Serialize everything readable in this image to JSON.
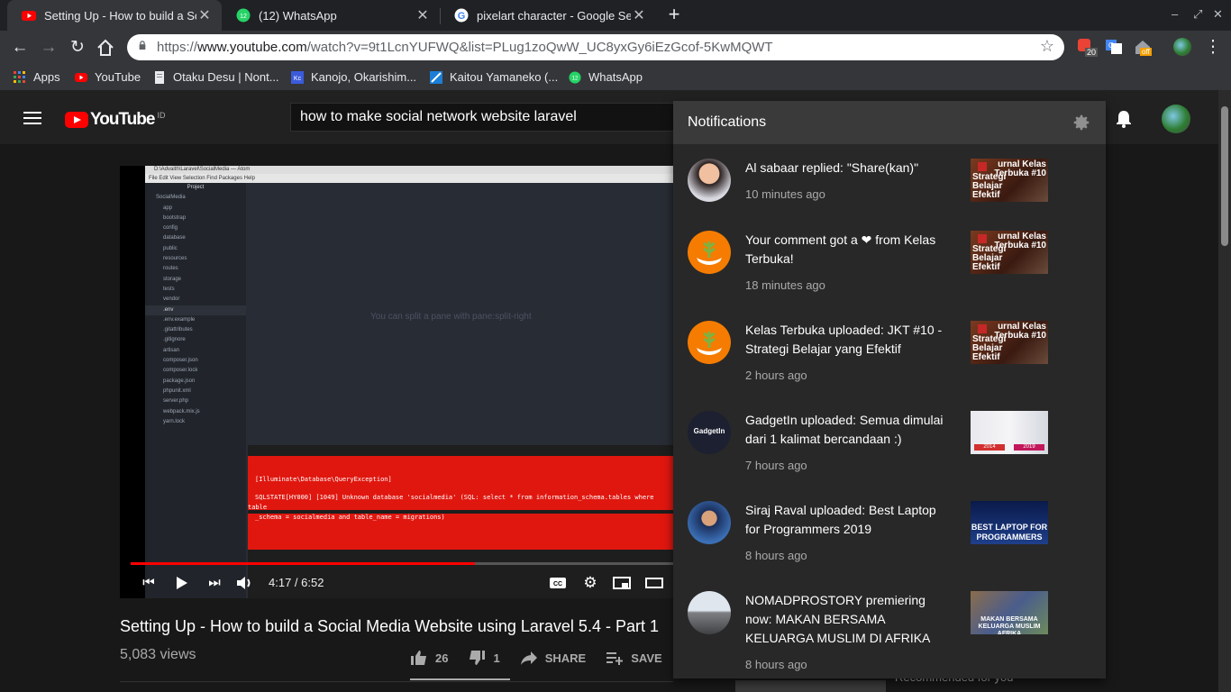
{
  "browser": {
    "tabs": [
      {
        "title": "Setting Up - How to build a Soci",
        "active": true
      },
      {
        "title": "(12) WhatsApp",
        "active": false
      },
      {
        "title": "pixelart character - Google Sea",
        "active": false
      }
    ],
    "new_tab_label": "+",
    "url_prefix": "https://",
    "url_host": "www.youtube.com",
    "url_path": "/watch?v=9t1LcnYUFWQ&list=PLug1zoQwW_UC8yxGy6iEzGcof-5KwMQWT",
    "extension_badges": {
      "pocket": "20",
      "ext3": "off"
    },
    "whatsapp_badge": "12",
    "bookmarks": [
      {
        "label": "Apps",
        "icon": "apps-grid-icon"
      },
      {
        "label": "YouTube",
        "icon": "youtube-icon"
      },
      {
        "label": "Otaku Desu | Nont...",
        "icon": "page-icon"
      },
      {
        "label": "Kanojo, Okarishim...",
        "icon": "kc-icon"
      },
      {
        "label": "Kaitou Yamaneko (...",
        "icon": "ky-icon"
      },
      {
        "label": "WhatsApp",
        "icon": "whatsapp-icon"
      }
    ]
  },
  "youtube": {
    "logo_text": "YouTube",
    "logo_country": "ID",
    "search_value": "how to make social network website laravel"
  },
  "video": {
    "editor": {
      "titlebar": "D:\\Advaith\\Laravel\\SocialMedia — Atom",
      "menu": "File   Edit   View   Selection   Find   Packages   Help",
      "project_label": "Project",
      "tree": [
        "SocialMedia",
        "app",
        "bootstrap",
        "config",
        "database",
        "public",
        "resources",
        "routes",
        "storage",
        "tests",
        "vendor",
        ".env",
        ".env.example",
        ".gitattributes",
        ".gitignore",
        "artisan",
        "composer.json",
        "composer.lock",
        "package.json",
        "phpunit.xml",
        "server.php",
        "webpack.mix.js",
        "yarn.lock"
      ],
      "hint": "You can split a pane with pane:split-right",
      "error_lines": [
        "[Illuminate\\Database\\QueryException]",
        "SQLSTATE[HY000] [1049] Unknown database 'socialmedia' (SQL: select * from information_schema.tables where",
        "table",
        "_schema = socialmedia and table_name = migrations)"
      ]
    },
    "progress": 0.635,
    "buffered": 0.925,
    "time_current": "4:17",
    "time_total": "6:52",
    "title": "Setting Up - How to build a Social Media Website using Laravel 5.4 - Part 1",
    "views": "5,083 views",
    "likes": "26",
    "dislikes": "1",
    "share_label": "SHARE",
    "save_label": "SAVE",
    "sidebar_peek": "Recommended for you"
  },
  "notifications": {
    "title": "Notifications",
    "items": [
      {
        "text": "Al sabaar replied: \"Share(kan)\"",
        "time": "10 minutes ago",
        "avatar": "person-avatar",
        "thumb": "kelas-terbuka",
        "thumb_title": "urnal Kelas Terbuka #10",
        "thumb_sub": "Strategi Belajar Efektif"
      },
      {
        "text": "Your comment got a ❤ from Kelas Terbuka!",
        "time": "18 minutes ago",
        "avatar": "kelas-terbuka-avatar",
        "thumb": "kelas-terbuka",
        "thumb_title": "urnal Kelas Terbuka #10",
        "thumb_sub": "Strategi Belajar Efektif"
      },
      {
        "text": "Kelas Terbuka uploaded: JKT #10 - Strategi Belajar yang Efektif",
        "time": "2 hours ago",
        "avatar": "kelas-terbuka-avatar",
        "thumb": "kelas-terbuka",
        "thumb_title": "urnal Kelas Terbuka #10",
        "thumb_sub": "Strategi Belajar Efektif"
      },
      {
        "text": "GadgetIn uploaded: Semua dimulai dari 1 kalimat bercandaan :)",
        "time": "7 hours ago",
        "avatar": "gadgetin-avatar",
        "avatar_text": "GadgetIn",
        "thumb": "gadgetin",
        "thumb_tag1": "2014",
        "thumb_tag2": "2019"
      },
      {
        "text": "Siraj Raval uploaded: Best Laptop for Programmers 2019",
        "time": "8 hours ago",
        "avatar": "siraj-avatar",
        "thumb": "siraj",
        "thumb_title": "BEST LAPTOP FOR PROGRAMMERS"
      },
      {
        "text": "NOMADPROSTORY premiering now: MAKAN BERSAMA KELUARGA MUSLIM DI AFRIKA",
        "time": "8 hours ago",
        "avatar": "nomad-avatar",
        "thumb": "nomad",
        "thumb_title": "MAKAN BERSAMA KELUARGA MUSLIM AFRIKA"
      }
    ]
  },
  "colors": {
    "brand_red": "#ff0000",
    "kelas_orange": "#f57c00",
    "error_red": "#e0170f"
  }
}
